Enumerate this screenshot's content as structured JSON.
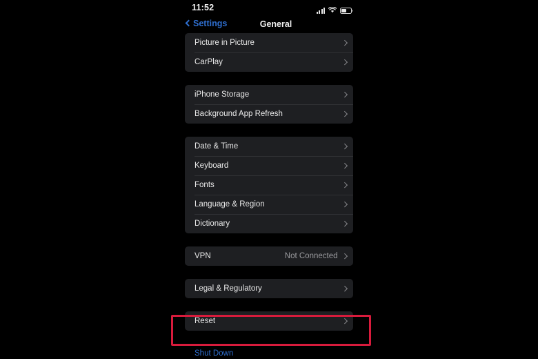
{
  "status_bar": {
    "time": "11:52",
    "icons": [
      "cellular-signal-icon",
      "wifi-icon",
      "battery-icon"
    ]
  },
  "nav_bar": {
    "back_label": "Settings",
    "back_icon": "chevron-left-icon",
    "title": "General"
  },
  "colors": {
    "screen_background": "#000000",
    "row_background": "#1e1f22",
    "primary_text": "#e9e9e9",
    "secondary_text": "#9a9a9e",
    "accent_blue": "#2f6fd0",
    "highlight_red": "#d81b3c",
    "divider": "#303135"
  },
  "annotation": {
    "name": "reset-highlight-box",
    "color": "#d81b3c",
    "targets": "Reset"
  },
  "sections": [
    {
      "name": "media-section",
      "rows": [
        {
          "label": "Picture in Picture",
          "value": "",
          "accessory": "chevron-right-icon",
          "link": false
        },
        {
          "label": "CarPlay",
          "value": "",
          "accessory": "chevron-right-icon",
          "link": false
        }
      ]
    },
    {
      "name": "storage-section",
      "rows": [
        {
          "label": "iPhone Storage",
          "value": "",
          "accessory": "chevron-right-icon",
          "link": false
        },
        {
          "label": "Background App Refresh",
          "value": "",
          "accessory": "chevron-right-icon",
          "link": false
        }
      ]
    },
    {
      "name": "localization-section",
      "rows": [
        {
          "label": "Date & Time",
          "value": "",
          "accessory": "chevron-right-icon",
          "link": false
        },
        {
          "label": "Keyboard",
          "value": "",
          "accessory": "chevron-right-icon",
          "link": false
        },
        {
          "label": "Fonts",
          "value": "",
          "accessory": "chevron-right-icon",
          "link": false
        },
        {
          "label": "Language & Region",
          "value": "",
          "accessory": "chevron-right-icon",
          "link": false
        },
        {
          "label": "Dictionary",
          "value": "",
          "accessory": "chevron-right-icon",
          "link": false
        }
      ]
    },
    {
      "name": "vpn-section",
      "rows": [
        {
          "label": "VPN",
          "value": "Not Connected",
          "accessory": "chevron-right-icon",
          "link": false
        }
      ]
    },
    {
      "name": "legal-section",
      "rows": [
        {
          "label": "Legal & Regulatory",
          "value": "",
          "accessory": "chevron-right-icon",
          "link": false
        }
      ]
    },
    {
      "name": "reset-section",
      "rows": [
        {
          "label": "Reset",
          "value": "",
          "accessory": "chevron-right-icon",
          "link": false
        }
      ]
    },
    {
      "name": "shutdown-section",
      "rows": [
        {
          "label": "Shut Down",
          "value": "",
          "accessory": "",
          "link": true
        }
      ]
    }
  ]
}
